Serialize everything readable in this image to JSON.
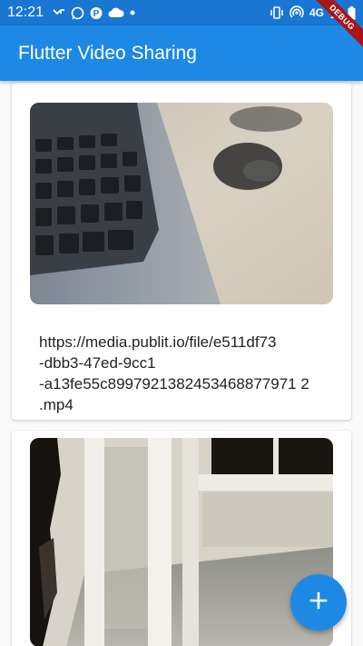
{
  "status_bar": {
    "time": "12:21",
    "network": "4G",
    "left_icons": [
      "missed-call-icon",
      "whatsapp-icon",
      "p-app-icon",
      "cloud-icon",
      "dot-icon"
    ],
    "right_icons": [
      "vibrate-icon",
      "hotspot-icon",
      "signal-icon",
      "battery-icon"
    ]
  },
  "app_bar": {
    "title": "Flutter Video Sharing"
  },
  "debug_banner": "DEBUG",
  "videos": [
    {
      "url": "https://media.publit.io/file/e511df73-dbb3-47ed-9cc1-a13fe55c8997921382453468877971 2.mp4",
      "url_lines": [
        "https://media.publit.io/file/e511df73",
        "-dbb3-47ed-9cc1",
        "-a13fe55c8997921382453468877971 2",
        ".mp4"
      ]
    },
    {
      "url": ""
    }
  ],
  "fab": {
    "icon": "add-icon",
    "label": "+"
  },
  "colors": {
    "primary": "#1e88e5",
    "primary_dark": "#1976d2"
  }
}
